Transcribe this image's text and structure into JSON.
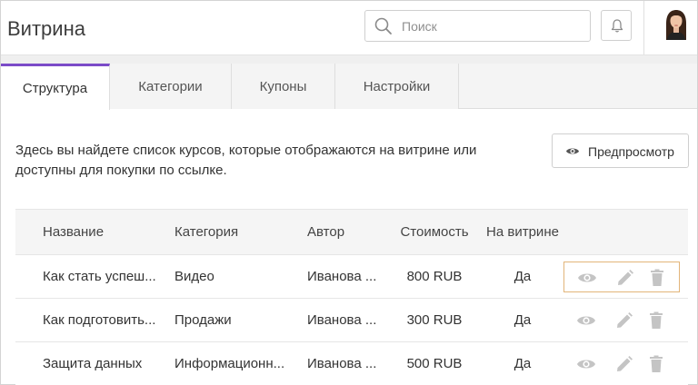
{
  "header": {
    "title": "Витрина",
    "search_placeholder": "Поиск"
  },
  "tabs": [
    {
      "label": "Структура",
      "active": true
    },
    {
      "label": "Категории",
      "active": false
    },
    {
      "label": "Купоны",
      "active": false
    },
    {
      "label": "Настройки",
      "active": false
    }
  ],
  "description": "Здесь вы найдете список курсов, которые отображаются на витрине или доступны для покупки по ссылке.",
  "preview_button": "Предпросмотр",
  "table": {
    "columns": [
      "Название",
      "Категория",
      "Автор",
      "Стоимость",
      "На витрине"
    ],
    "rows": [
      {
        "name": "Как стать успеш...",
        "category": "Видео",
        "author": "Иванова ...",
        "price": "800 RUB",
        "on_showcase": "Да"
      },
      {
        "name": "Как подготовить...",
        "category": "Продажи",
        "author": "Иванова ...",
        "price": "300 RUB",
        "on_showcase": "Да"
      },
      {
        "name": "Защита данных",
        "category": "Информационн...",
        "author": "Иванова ...",
        "price": "500 RUB",
        "on_showcase": "Да"
      }
    ]
  },
  "colors": {
    "accent": "#7b4bc8",
    "icon_grey": "#c4c4c4",
    "focus_border": "#e2b57a"
  },
  "icons": [
    "search-icon",
    "bell-icon",
    "avatar",
    "eye-icon",
    "edit-icon",
    "trash-icon"
  ]
}
